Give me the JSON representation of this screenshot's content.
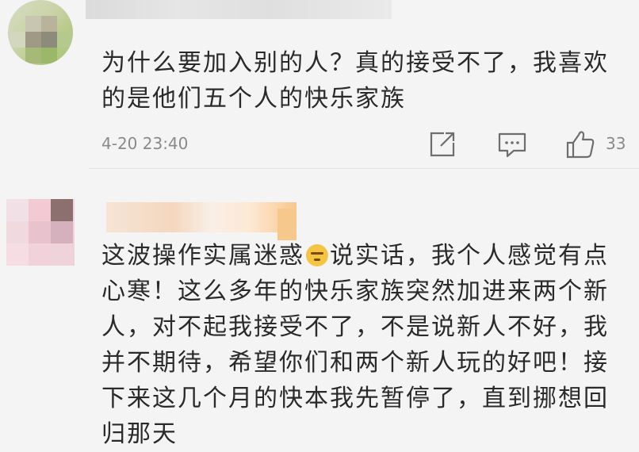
{
  "comments": [
    {
      "timestamp": "4-20 23:40",
      "text": "为什么要加入别的人？真的接受不了，我喜欢的是他们五个人的快乐家族",
      "likes": "33"
    },
    {
      "text_before_emoji": "这波操作实属迷惑",
      "emoji": "speechless-face",
      "text_after_emoji": "说实话，我个人感觉有点心寒！这么多年的快乐家族突然加进来两个新人，对不起我接受不了，不是说新人不好，我并不期待，希望你们和两个新人玩的好吧！接下来这几个月的快本我先暂停了，直到挪想回归那天"
    }
  ],
  "icons": {
    "share": "share-icon",
    "reply": "comment-icon",
    "like": "thumbs-up-icon"
  },
  "colors": {
    "background": "#f4f4f4",
    "text": "#2a2a2a",
    "meta": "#8a8a8a"
  }
}
